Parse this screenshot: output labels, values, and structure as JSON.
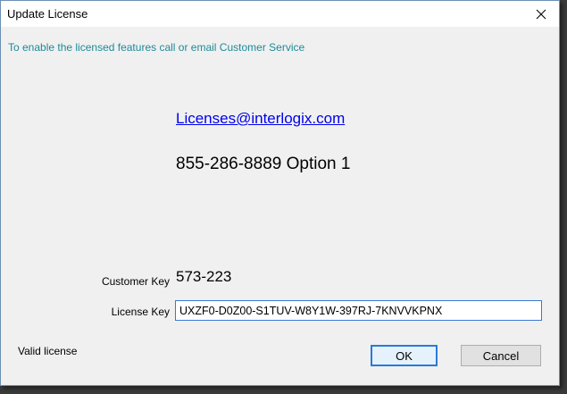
{
  "window": {
    "title": "Update License"
  },
  "info": {
    "message": "To enable the licensed features call or email Customer Service"
  },
  "contact": {
    "email": "Licenses@interlogix.com",
    "phone": "855-286-8889 Option 1"
  },
  "customer_key": {
    "label": "Customer Key",
    "value": "573-223"
  },
  "license_key": {
    "label": "License Key",
    "value": "UXZF0-D0Z00-S1TUV-W8Y1W-397RJ-7KNVVKPNX"
  },
  "status": {
    "text": "Valid license"
  },
  "buttons": {
    "ok_label": "OK",
    "cancel_label": "Cancel"
  },
  "icons": {
    "close": "close-icon"
  },
  "colors": {
    "info_text": "#1e8a99",
    "link": "#0000ee",
    "input_border": "#3b78d8",
    "default_button_border": "#2a7ad8"
  }
}
